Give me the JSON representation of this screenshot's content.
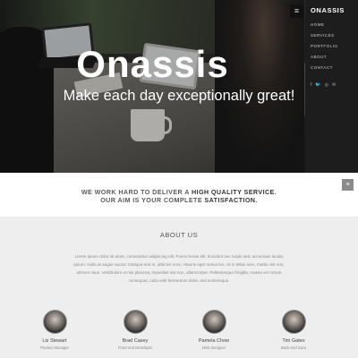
{
  "hero": {
    "title": "Onassis",
    "tagline": "Make each day exceptionally great!"
  },
  "menu_button": {
    "icon": "hamburger-icon",
    "glyph": "≡"
  },
  "sidebar": {
    "brand": "ONASSIS",
    "items": [
      {
        "label": "HOME"
      },
      {
        "label": "SERVICES"
      },
      {
        "label": "PORTFOLIO"
      },
      {
        "label": "ABOUT"
      },
      {
        "label": "CONTACT"
      }
    ],
    "social": [
      {
        "icon": "facebook-icon",
        "glyph": "f"
      },
      {
        "icon": "twitter-icon",
        "glyph": "🐦"
      },
      {
        "icon": "dribbble-icon",
        "glyph": "◎"
      },
      {
        "icon": "email-icon",
        "glyph": "✉"
      }
    ]
  },
  "band": {
    "line1_pre": "WE WORK HARD TO DELIVER A ",
    "line1_bold": "HIGH QUALITY SERVICE",
    "line1_post": ".",
    "line2_pre": "OUR AIM IS YOUR COMPLETE ",
    "line2_bold": "SATISFACTION",
    "line2_post": ".",
    "button_icon": "menu-lines-icon",
    "button_glyph": "≡"
  },
  "about": {
    "title": "ABOUT US",
    "text": "Lorem ipsum dolor sit amet, consectetur adipiscing elit. Fusce lectus elit, tincidunt nec turpis sed, accumsan iaculis ipsum. Nulla at augue auctor, tristique erat in, ultricies nunc. Mauris eget metus leo. Ut in tellus sem, mattis nisl non, ultrices risus. Vestibulum ut nisi placerat, imperdiet nisi non, ullamcorper. Pellentesque fringilla, massa vel rutrum consequat, nulla velit fermentum dolor, sed scelerisque."
  },
  "team": [
    {
      "name": "Liz Stewart",
      "role": "Product Manager"
    },
    {
      "name": "Brad Casey",
      "role": "Front-end Developer"
    },
    {
      "name": "Pamela Chow",
      "role": "Web Designer"
    },
    {
      "name": "Tim Gates",
      "role": "Back-end Guru"
    }
  ]
}
